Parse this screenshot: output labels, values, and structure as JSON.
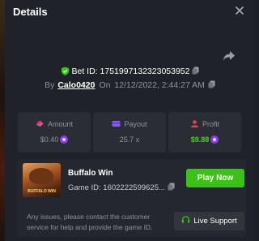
{
  "modal": {
    "title": "Details",
    "close_icon": "close-icon",
    "share_icon": "share-icon"
  },
  "bet": {
    "id_label": "Bet ID:",
    "id_value": "1751997132323053952",
    "by_label": "By",
    "user": "Calo0420",
    "on_label": "On",
    "date": "12/12/2022, 2:44:27 AM"
  },
  "stats": [
    {
      "label": "Amount",
      "value": "$0.40",
      "icon": "coins-icon",
      "coin": true,
      "value_color": "#8d939c"
    },
    {
      "label": "Payout",
      "value": "25.7 x",
      "icon": "payout-icon",
      "coin": false,
      "value_color": "#8d939c"
    },
    {
      "label": "Profit",
      "value": "$9.88",
      "icon": "profit-icon",
      "coin": true,
      "value_color": "#4ad418"
    }
  ],
  "game": {
    "name": "Buffalo Win",
    "thumb_text": "BUFFALO WIN",
    "id_label": "Game ID:",
    "id_value": "1602222599625...",
    "play_label": "Play Now",
    "help_text": "Any issues, please contact the customer service for help and provide the game ID.",
    "live_label": "Live Support"
  },
  "colors": {
    "accent_green": "#3bc117",
    "profit_green": "#4ad418",
    "amount_icon": "#e64f8a",
    "payout_icon": "#8a5cf6",
    "profit_icon": "#e8434e",
    "shield_green": "#3bc117",
    "coin_purple": "#8a3cf0"
  }
}
